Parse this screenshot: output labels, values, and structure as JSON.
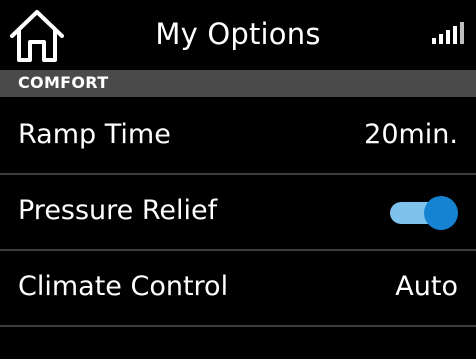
{
  "header": {
    "title": "My Options",
    "home_icon": "home-icon",
    "signal_icon": "signal-strength-icon"
  },
  "section": {
    "label": "COMFORT"
  },
  "rows": [
    {
      "label": "Ramp Time",
      "value": "20min."
    },
    {
      "label": "Pressure Relief",
      "toggle_on": true
    },
    {
      "label": "Climate Control",
      "value": "Auto"
    }
  ],
  "colors": {
    "background": "#000000",
    "section_bar": "#4a4a4a",
    "toggle_track": "#7fc3ec",
    "toggle_knob": "#1583d1",
    "divider": "#3e3e3e"
  }
}
